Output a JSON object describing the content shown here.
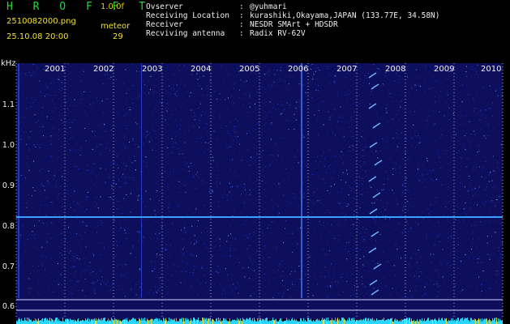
{
  "header": {
    "brand": "H R O F F T",
    "version": "1.0.0f",
    "filename": "2510082000.png",
    "timestamp": "25.10.08 20:00",
    "meteor_label": "meteor",
    "meteor_count": "29",
    "info": [
      {
        "key": "Ovserver",
        "value": "@yuhmari"
      },
      {
        "key": "Receiving Location",
        "value": "kurashiki,Okayama,JAPAN (133.77E, 34.58N)"
      },
      {
        "key": "Receiver",
        "value": "NESDR SMArt + HDSDR"
      },
      {
        "key": "Recviving antenna",
        "value": "Radix RV-62V"
      }
    ]
  },
  "plot": {
    "y_unit": "kHz",
    "y_ticks": [
      "1.1",
      "1.0",
      "0.9",
      "0.8",
      "0.7",
      "0.6"
    ],
    "x_ticks": [
      "2001",
      "2002",
      "2003",
      "2004",
      "2005",
      "2006",
      "2007",
      "2008",
      "2009",
      "2010"
    ],
    "carrier_khz": 0.82,
    "colors": {
      "background": "#000000",
      "waterfall": "#0d0f5c",
      "grid": "#ffffff",
      "carrier": "#3aa0ff",
      "level": "#2ad6ff",
      "level_peaks": "#f0e028"
    }
  }
}
